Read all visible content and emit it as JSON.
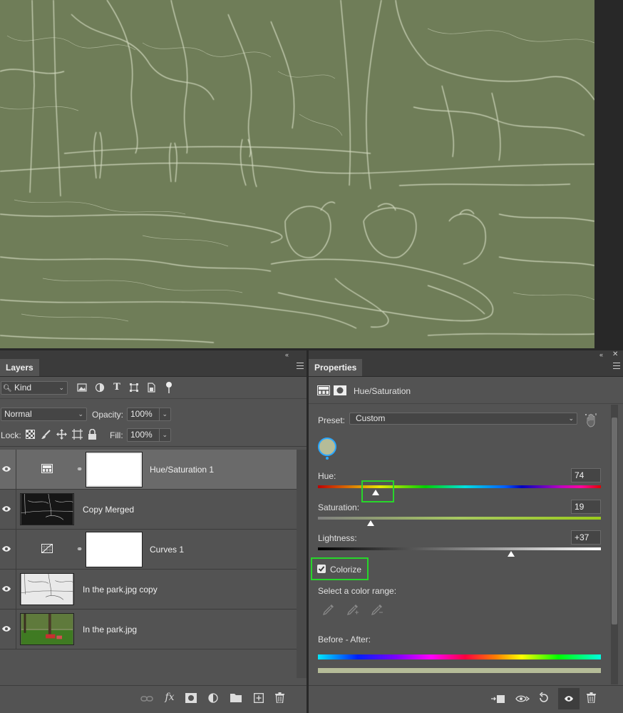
{
  "layers_panel": {
    "tab_label": "Layers",
    "filter_kind": "Kind",
    "blend_mode": "Normal",
    "opacity_label": "Opacity:",
    "opacity_value": "100%",
    "lock_label": "Lock:",
    "fill_label": "Fill:",
    "fill_value": "100%",
    "layers": [
      {
        "name": "Hue/Saturation 1",
        "type": "adjustment-hue",
        "selected": true
      },
      {
        "name": "Copy Merged",
        "type": "pixel"
      },
      {
        "name": "Curves 1",
        "type": "adjustment-curves"
      },
      {
        "name": "In the park.jpg copy",
        "type": "pixel"
      },
      {
        "name": "In the park.jpg",
        "type": "pixel"
      }
    ]
  },
  "properties_panel": {
    "tab_label": "Properties",
    "adjustment_title": "Hue/Saturation",
    "preset_label": "Preset:",
    "preset_value": "Custom",
    "hue_label": "Hue:",
    "hue_value": "74",
    "saturation_label": "Saturation:",
    "saturation_value": "19",
    "lightness_label": "Lightness:",
    "lightness_value": "+37",
    "colorize_label": "Colorize",
    "colorize_checked": true,
    "color_range_label": "Select a color range:",
    "before_after_label": "Before - After:",
    "colorize_color": "#b5bc98",
    "highlight_color": "#27d62a"
  },
  "canvas": {
    "tint": "#6f7d58",
    "line_color": "#e4ead2"
  }
}
